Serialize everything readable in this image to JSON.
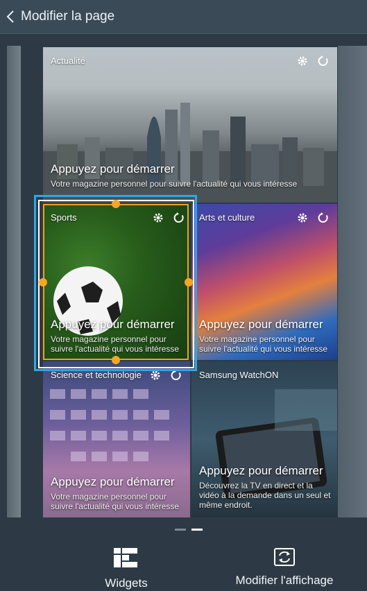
{
  "header": {
    "back_icon": "chevron-left-icon",
    "title": "Modifier la page"
  },
  "tiles": {
    "actualite": {
      "label": "Actualité",
      "cta": "Appuyez pour démarrer",
      "desc": "Votre magazine personnel pour suivre l'actualité qui vous intéresse"
    },
    "sports": {
      "label": "Sports",
      "cta": "Appuyez pour démarrer",
      "desc": "Votre magazine personnel pour suivre l'actualité qui vous intéresse"
    },
    "arts": {
      "label": "Arts et culture",
      "cta": "Appuyez pour démarrer",
      "desc": "Votre magazine personnel pour suivre l'actualité qui vous intéresse"
    },
    "science": {
      "label": "Science et technologie",
      "cta": "Appuyez pour démarrer",
      "desc": "Votre magazine personnel pour suivre l'actualité qui vous intéresse"
    },
    "watchon": {
      "label": "Samsung WatchON",
      "cta": "Appuyez pour démarrer",
      "desc": "Découvrez la TV en direct et la vidéo à la demande dans un seul et même endroit."
    }
  },
  "pager": {
    "pages": 2,
    "active": 2
  },
  "bottom": {
    "widgets_label": "Widgets",
    "modify_label": "Modifier l'affichage"
  },
  "colors": {
    "selection": "#2ea7e4",
    "handles": "#f5a623",
    "header_bg": "#3a4a57"
  }
}
